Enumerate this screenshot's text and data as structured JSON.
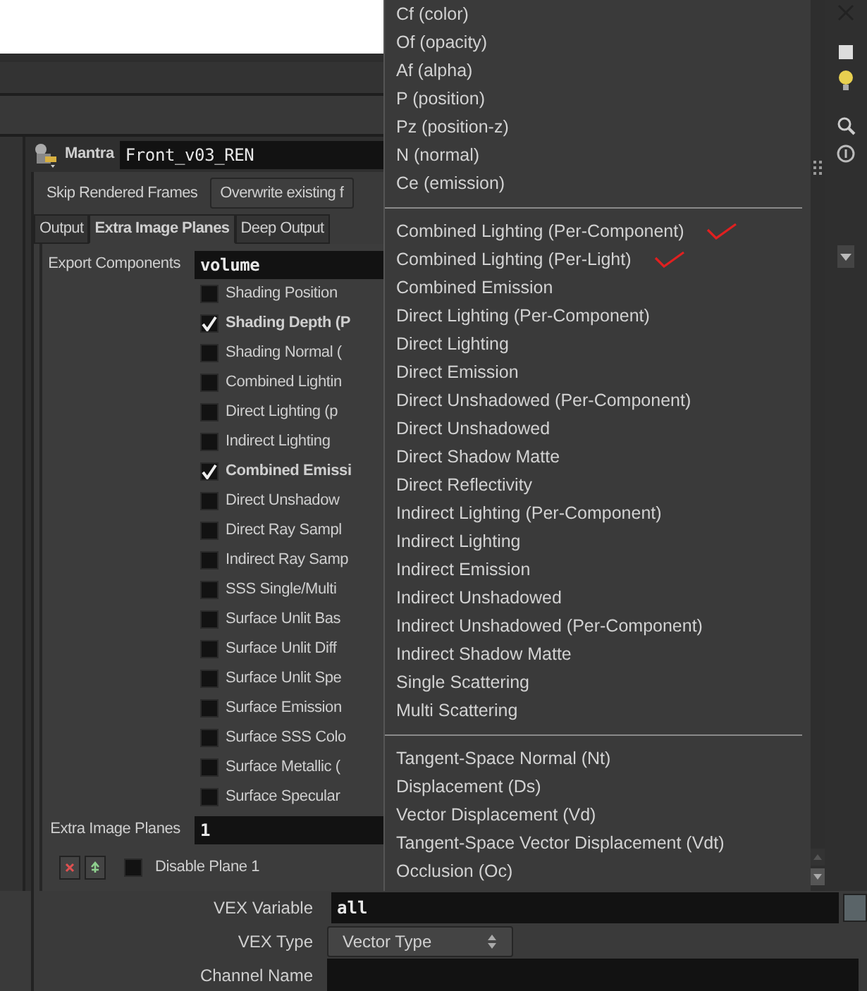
{
  "header": {
    "node_type": "Mantra",
    "node_name": "Front_v03_REN"
  },
  "buttons": [
    "Skip Rendered Frames",
    "Overwrite existing f"
  ],
  "tabs": [
    {
      "label": "Output",
      "selected": false
    },
    {
      "label": "Extra Image Planes",
      "selected": true
    },
    {
      "label": "Deep Output",
      "selected": false
    }
  ],
  "export_components": {
    "label": "Export Components",
    "value": "volume"
  },
  "components": [
    {
      "label": "Shading Position",
      "checked": false
    },
    {
      "label": "Shading Depth (P",
      "checked": true
    },
    {
      "label": "Shading Normal (",
      "checked": false
    },
    {
      "label": "Combined Lightin",
      "checked": false
    },
    {
      "label": "Direct Lighting (p",
      "checked": false
    },
    {
      "label": "Indirect Lighting",
      "checked": false
    },
    {
      "label": "Combined Emissi",
      "checked": true
    },
    {
      "label": "Direct Unshadow",
      "checked": false
    },
    {
      "label": "Direct Ray Sampl",
      "checked": false
    },
    {
      "label": "Indirect Ray Samp",
      "checked": false
    },
    {
      "label": "SSS Single/Multi",
      "checked": false
    },
    {
      "label": "Surface Unlit Bas",
      "checked": false
    },
    {
      "label": "Surface Unlit Diff",
      "checked": false
    },
    {
      "label": "Surface Unlit Spe",
      "checked": false
    },
    {
      "label": "Surface Emission",
      "checked": false
    },
    {
      "label": "Surface SSS Colo",
      "checked": false
    },
    {
      "label": "Surface Metallic (",
      "checked": false
    },
    {
      "label": "Surface Specular",
      "checked": false
    }
  ],
  "extra_image_planes": {
    "label": "Extra Image Planes",
    "value": "1"
  },
  "plane": {
    "label": "Disable Plane 1",
    "checked": false
  },
  "vex_variable": {
    "label": "VEX Variable",
    "value": "all"
  },
  "vex_type": {
    "label": "VEX Type",
    "value": "Vector Type"
  },
  "channel_name": {
    "label": "Channel Name"
  },
  "menu": {
    "groups": [
      [
        {
          "label": "Cf (color)",
          "annotated": false
        },
        {
          "label": "Of (opacity)",
          "annotated": false
        },
        {
          "label": "Af (alpha)",
          "annotated": false
        },
        {
          "label": "P (position)",
          "annotated": false
        },
        {
          "label": "Pz (position-z)",
          "annotated": false
        },
        {
          "label": "N (normal)",
          "annotated": false
        },
        {
          "label": "Ce (emission)",
          "annotated": false
        }
      ],
      [
        {
          "label": "Combined Lighting (Per-Component)",
          "annotated": true
        },
        {
          "label": "Combined Lighting (Per-Light)",
          "annotated": true
        },
        {
          "label": "Combined Emission",
          "annotated": false
        },
        {
          "label": "Direct Lighting (Per-Component)",
          "annotated": false
        },
        {
          "label": "Direct Lighting",
          "annotated": false
        },
        {
          "label": "Direct Emission",
          "annotated": false
        },
        {
          "label": "Direct Unshadowed (Per-Component)",
          "annotated": false
        },
        {
          "label": "Direct Unshadowed",
          "annotated": false
        },
        {
          "label": "Direct Shadow Matte",
          "annotated": false
        },
        {
          "label": "Direct Reflectivity",
          "annotated": false
        },
        {
          "label": "Indirect Lighting (Per-Component)",
          "annotated": false
        },
        {
          "label": "Indirect Lighting",
          "annotated": false
        },
        {
          "label": "Indirect Emission",
          "annotated": false
        },
        {
          "label": "Indirect Unshadowed",
          "annotated": false
        },
        {
          "label": "Indirect Unshadowed (Per-Component)",
          "annotated": false
        },
        {
          "label": "Indirect Shadow Matte",
          "annotated": false
        },
        {
          "label": "Single Scattering",
          "annotated": false
        },
        {
          "label": "Multi Scattering",
          "annotated": false
        }
      ],
      [
        {
          "label": "Tangent-Space Normal (Nt)",
          "annotated": false
        },
        {
          "label": "Displacement (Ds)",
          "annotated": false
        },
        {
          "label": "Vector Displacement (Vd)",
          "annotated": false
        },
        {
          "label": "Tangent-Space Vector Displacement (Vdt)",
          "annotated": false
        },
        {
          "label": "Occlusion (Oc)",
          "annotated": false
        }
      ]
    ]
  }
}
